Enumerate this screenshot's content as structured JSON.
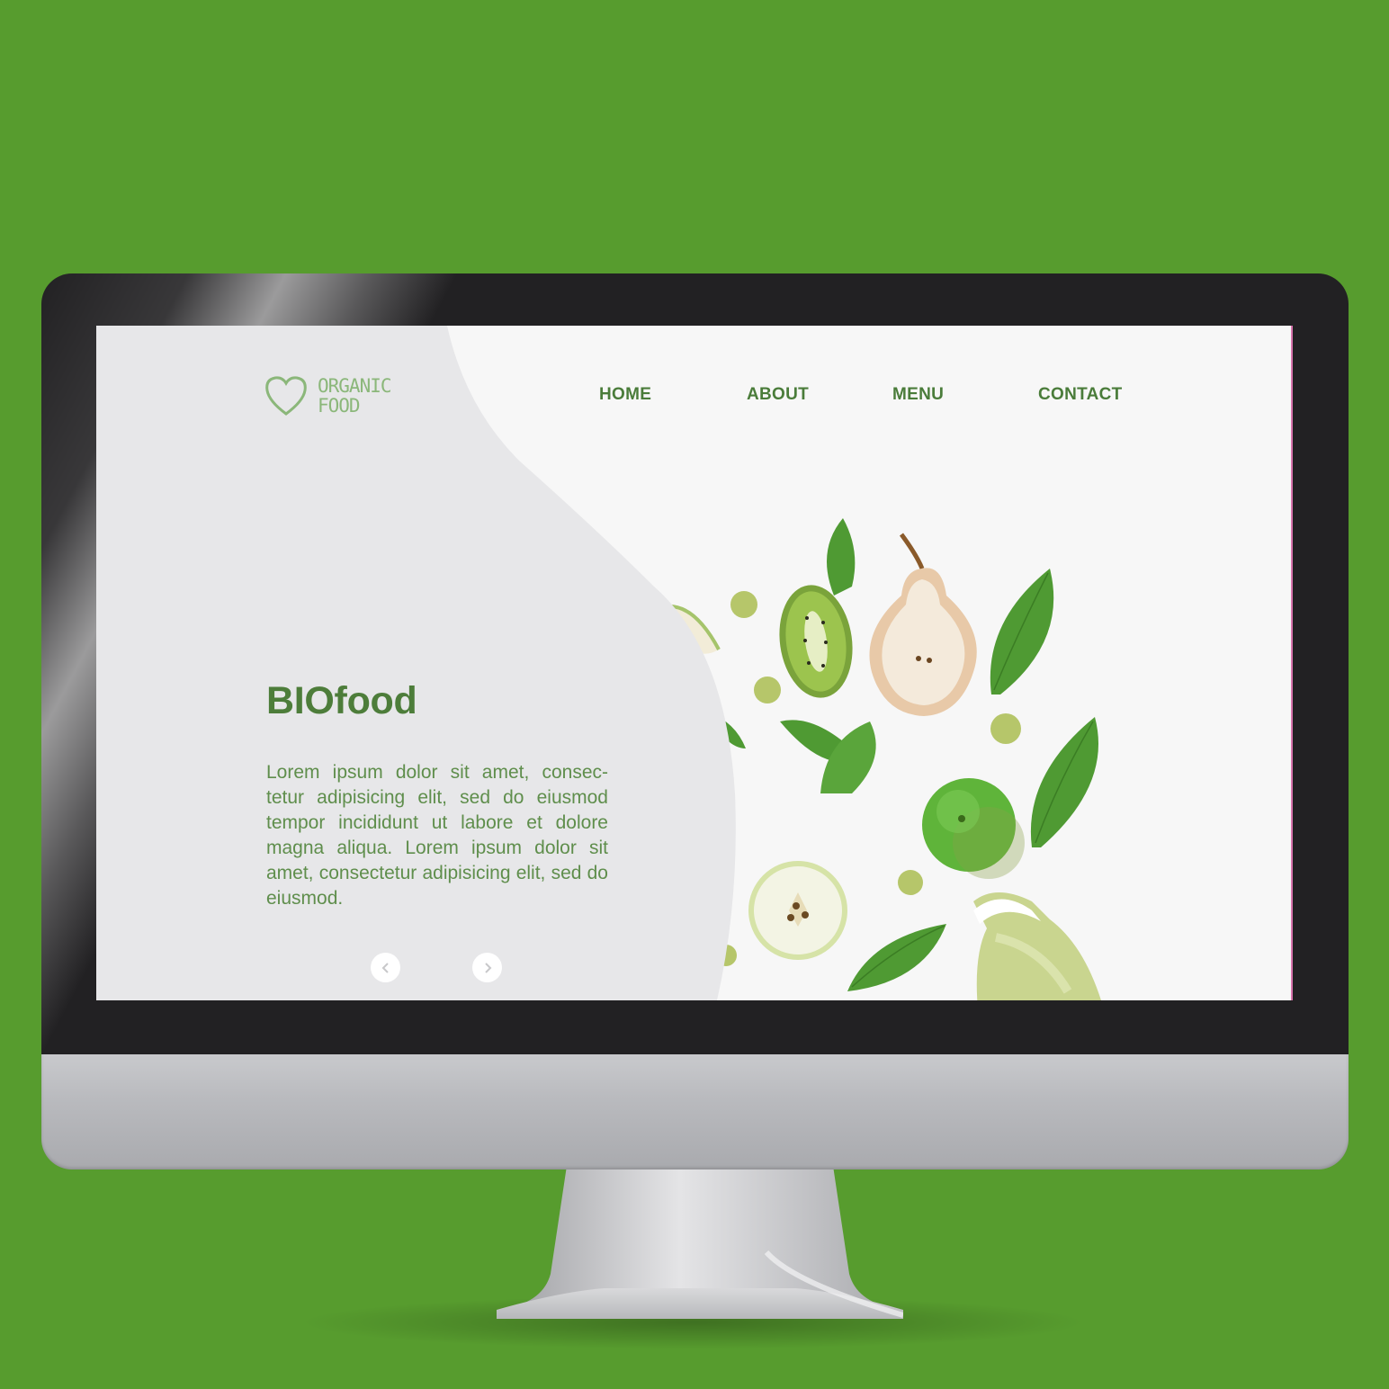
{
  "brand": {
    "logo_line1": "ORGANIC",
    "logo_line2": "FOOD",
    "logo_icon": "heart-outline-icon"
  },
  "nav": {
    "items": [
      {
        "label": "HOME"
      },
      {
        "label": "ABOUT"
      },
      {
        "label": "MENU"
      },
      {
        "label": "CONTACT"
      }
    ]
  },
  "hero": {
    "title": "BIOfood",
    "body": "Lorem ipsum dolor sit amet, consec-tetur adipisicing elit, sed do eiusmod tempor incididunt ut labore et dolore magna aliqua. Lorem ipsum dolor sit amet, consectetur adipisicing elit, sed do eiusmod."
  },
  "slider": {
    "prev_icon": "chevron-left-icon",
    "next_icon": "chevron-right-icon"
  },
  "colors": {
    "background": "#579c2e",
    "brand_green": "#4d7d3a",
    "logo_green": "#8bb77a",
    "blob_gray": "#e7e7e9",
    "bezel": "#222123"
  }
}
